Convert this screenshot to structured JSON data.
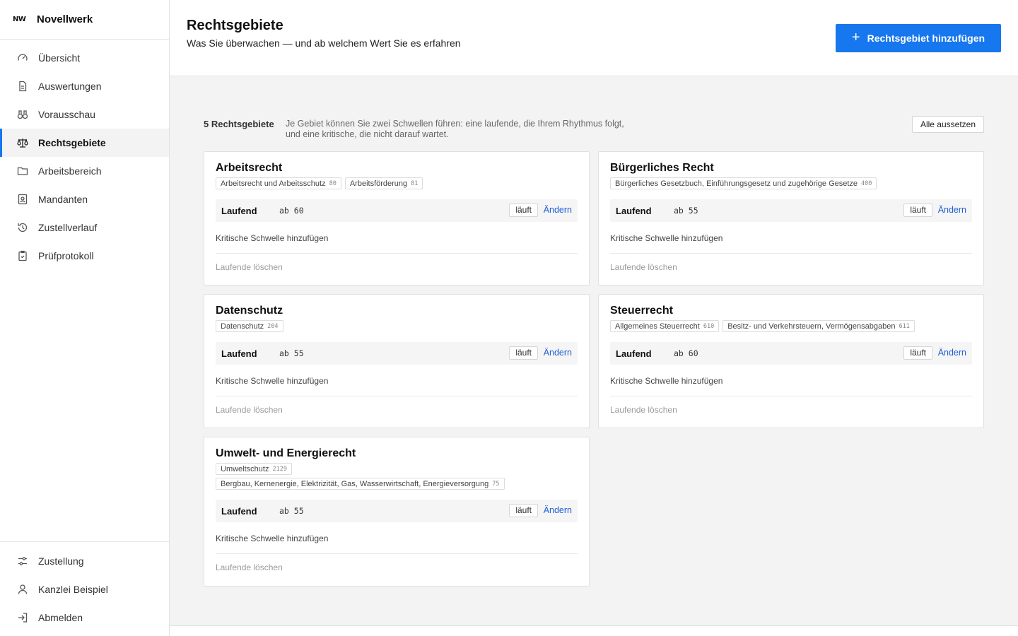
{
  "brand": {
    "logo": "NW",
    "name": "Novellwerk"
  },
  "nav": {
    "items": [
      {
        "label": "Übersicht",
        "icon": "gauge-icon",
        "active": false
      },
      {
        "label": "Auswertungen",
        "icon": "document-icon",
        "active": false
      },
      {
        "label": "Vorausschau",
        "icon": "binoculars-icon",
        "active": false
      },
      {
        "label": "Rechtsgebiete",
        "icon": "scale-icon",
        "active": true
      },
      {
        "label": "Arbeitsbereich",
        "icon": "folder-icon",
        "active": false
      },
      {
        "label": "Mandanten",
        "icon": "contact-card-icon",
        "active": false
      },
      {
        "label": "Zustellverlauf",
        "icon": "history-icon",
        "active": false
      },
      {
        "label": "Prüfprotokoll",
        "icon": "clipboard-icon",
        "active": false
      }
    ],
    "bottom": [
      {
        "label": "Zustellung",
        "icon": "sliders-icon"
      },
      {
        "label": "Kanzlei Beispiel",
        "icon": "user-icon"
      },
      {
        "label": "Abmelden",
        "icon": "logout-icon"
      }
    ]
  },
  "header": {
    "title": "Rechtsgebiete",
    "subtitle": "Was Sie überwachen — und ab welchem Wert Sie es erfahren",
    "add_button": "Rechtsgebiet hinzufügen",
    "add_icon": "plus-icon"
  },
  "summary": {
    "count": "5 Rechtsgebiete",
    "text": "Je Gebiet können Sie zwei Schwellen führen: eine laufende, die Ihrem Rhythmus folgt, und eine kritische, die nicht darauf wartet.",
    "pause_all": "Alle aussetzen"
  },
  "labels": {
    "threshold": "Laufend",
    "status": "läuft",
    "edit": "Ändern",
    "add_critical": "Kritische Schwelle hinzufügen",
    "delete": "Laufende löschen"
  },
  "areas": [
    {
      "title": "Arbeitsrecht",
      "tags": [
        {
          "name": "Arbeitsrecht und Arbeitsschutz",
          "code": "80"
        },
        {
          "name": "Arbeitsförderung",
          "code": "81"
        }
      ],
      "threshold": "ab 60"
    },
    {
      "title": "Bürgerliches Recht",
      "tags": [
        {
          "name": "Bürgerliches Gesetzbuch, Einführungsgesetz und zugehörige Gesetze",
          "code": "400"
        }
      ],
      "threshold": "ab 55"
    },
    {
      "title": "Datenschutz",
      "tags": [
        {
          "name": "Datenschutz",
          "code": "204"
        }
      ],
      "threshold": "ab 55"
    },
    {
      "title": "Steuerrecht",
      "tags": [
        {
          "name": "Allgemeines Steuerrecht",
          "code": "610"
        },
        {
          "name": "Besitz- und Verkehrsteuern, Vermögensabgaben",
          "code": "611"
        }
      ],
      "threshold": "ab 60"
    },
    {
      "title": "Umwelt- und Energierecht",
      "tags": [
        {
          "name": "Umweltschutz",
          "code": "2129"
        },
        {
          "name": "Bergbau, Kernenergie, Elektrizität, Gas, Wasserwirtschaft, Energieversorgung",
          "code": "75"
        }
      ],
      "threshold": "ab 55"
    }
  ],
  "colors": {
    "accent": "#1677ee",
    "link": "#1f5fd6"
  }
}
